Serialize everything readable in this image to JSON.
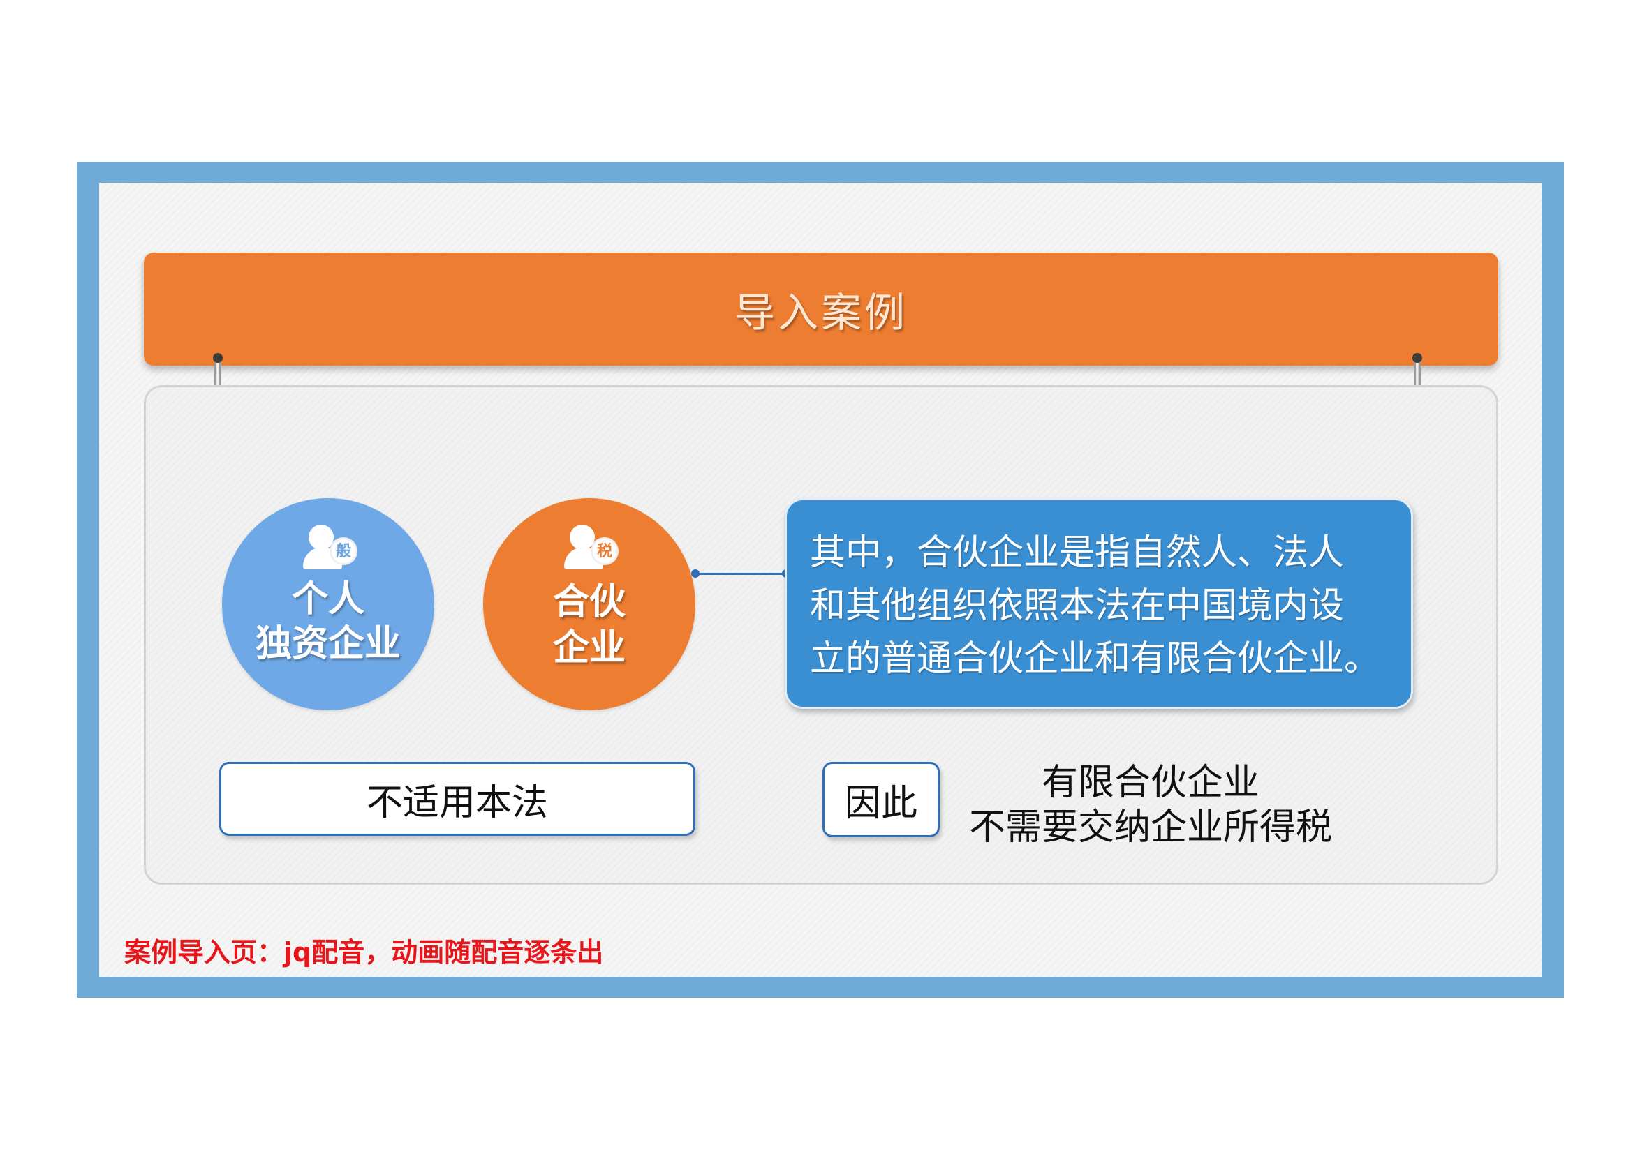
{
  "title": "导入案例",
  "circles": [
    {
      "icon_badge": "般",
      "icon": "user-badge-icon",
      "line1": "个人",
      "line2": "独资企业",
      "color": "#6fa8e6"
    },
    {
      "icon_badge": "税",
      "icon": "user-badge-icon",
      "line1": "合伙",
      "line2": "企业",
      "color": "#ed7d31"
    }
  ],
  "definition": {
    "lines": [
      "其中，合伙企业是指自然人、法人",
      "和其他组织依照本法在中国境内设",
      "立的普通合伙企业和有限合伙企业。"
    ],
    "color": "#3a8fd3"
  },
  "not_applicable": "不适用本法",
  "therefore": "因此",
  "conclusion": {
    "line1": "有限合伙企业",
    "line2": "不需要交纳企业所得税"
  },
  "note": "案例导入页：jq配音，动画随配音逐条出",
  "colors": {
    "frame": "#6fa9d6",
    "banner": "#ed7d31",
    "note": "#e8161b"
  }
}
